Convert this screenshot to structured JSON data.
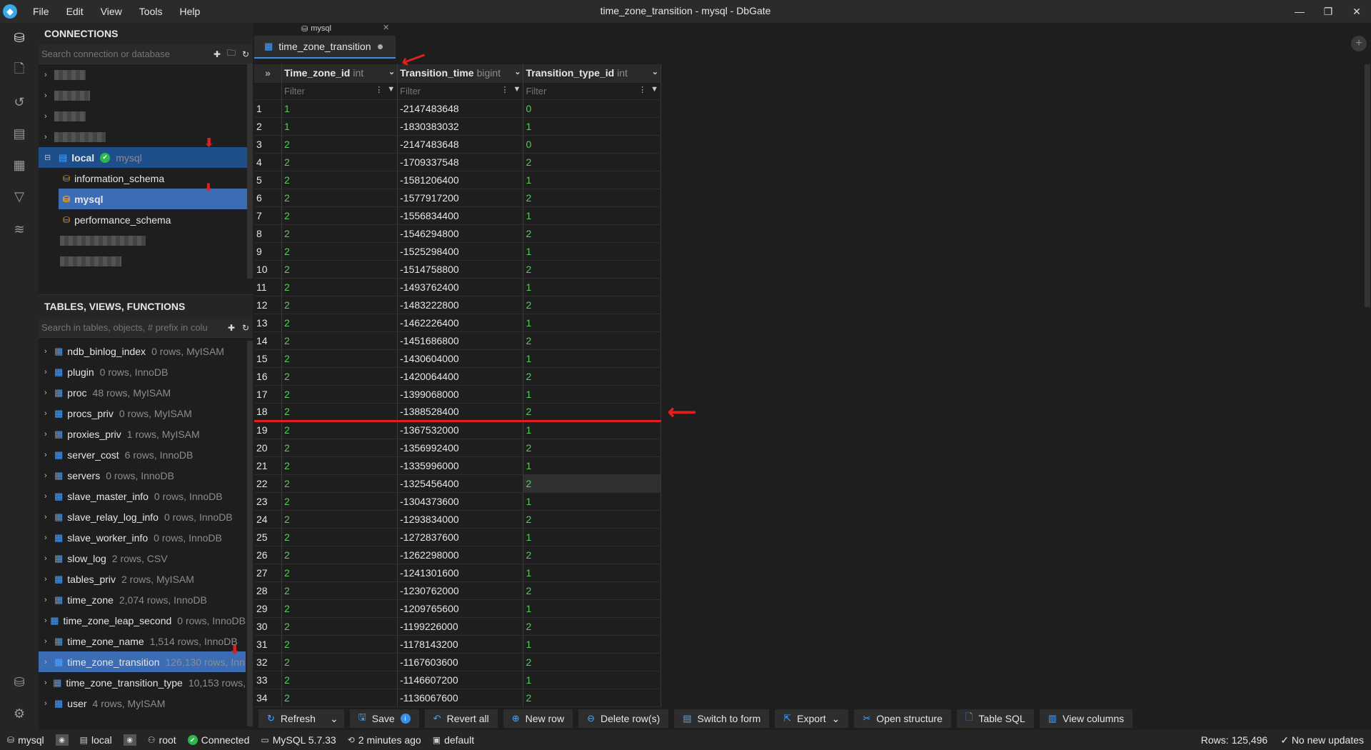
{
  "window": {
    "title": "time_zone_transition - mysql - DbGate"
  },
  "menu": [
    "File",
    "Edit",
    "View",
    "Tools",
    "Help"
  ],
  "connections": {
    "header": "CONNECTIONS",
    "search_placeholder": "Search connection or database",
    "local": {
      "name": "local",
      "db_label": "mysql"
    },
    "databases": [
      "information_schema",
      "mysql",
      "performance_schema"
    ]
  },
  "tables": {
    "header": "TABLES, VIEWS, FUNCTIONS",
    "search_placeholder": "Search in tables, objects, # prefix in colu",
    "items": [
      {
        "name": "ndb_binlog_index",
        "info": "0 rows, MyISAM"
      },
      {
        "name": "plugin",
        "info": "0 rows, InnoDB"
      },
      {
        "name": "proc",
        "info": "48 rows, MyISAM"
      },
      {
        "name": "procs_priv",
        "info": "0 rows, MyISAM"
      },
      {
        "name": "proxies_priv",
        "info": "1 rows, MyISAM"
      },
      {
        "name": "server_cost",
        "info": "6 rows, InnoDB"
      },
      {
        "name": "servers",
        "info": "0 rows, InnoDB"
      },
      {
        "name": "slave_master_info",
        "info": "0 rows, InnoDB"
      },
      {
        "name": "slave_relay_log_info",
        "info": "0 rows, InnoDB"
      },
      {
        "name": "slave_worker_info",
        "info": "0 rows, InnoDB"
      },
      {
        "name": "slow_log",
        "info": "2 rows, CSV"
      },
      {
        "name": "tables_priv",
        "info": "2 rows, MyISAM"
      },
      {
        "name": "time_zone",
        "info": "2,074 rows, InnoDB"
      },
      {
        "name": "time_zone_leap_second",
        "info": "0 rows, InnoDB"
      },
      {
        "name": "time_zone_name",
        "info": "1,514 rows, InnoDB"
      },
      {
        "name": "time_zone_transition",
        "info": "126,130 rows, Inn"
      },
      {
        "name": "time_zone_transition_type",
        "info": "10,153 rows,"
      },
      {
        "name": "user",
        "info": "4 rows, MyISAM"
      }
    ]
  },
  "tab": {
    "group_label": "mysql",
    "label": "time_zone_transition"
  },
  "grid": {
    "columns": [
      {
        "name": "Time_zone_id",
        "type": "int"
      },
      {
        "name": "Transition_time",
        "type": "bigint"
      },
      {
        "name": "Transition_type_id",
        "type": "int"
      }
    ],
    "filter_placeholder": "Filter",
    "rows": [
      [
        "1",
        "1",
        "-2147483648",
        "0"
      ],
      [
        "2",
        "1",
        "-1830383032",
        "1"
      ],
      [
        "3",
        "2",
        "-2147483648",
        "0"
      ],
      [
        "4",
        "2",
        "-1709337548",
        "2"
      ],
      [
        "5",
        "2",
        "-1581206400",
        "1"
      ],
      [
        "6",
        "2",
        "-1577917200",
        "2"
      ],
      [
        "7",
        "2",
        "-1556834400",
        "1"
      ],
      [
        "8",
        "2",
        "-1546294800",
        "2"
      ],
      [
        "9",
        "2",
        "-1525298400",
        "1"
      ],
      [
        "10",
        "2",
        "-1514758800",
        "2"
      ],
      [
        "11",
        "2",
        "-1493762400",
        "1"
      ],
      [
        "12",
        "2",
        "-1483222800",
        "2"
      ],
      [
        "13",
        "2",
        "-1462226400",
        "1"
      ],
      [
        "14",
        "2",
        "-1451686800",
        "2"
      ],
      [
        "15",
        "2",
        "-1430604000",
        "1"
      ],
      [
        "16",
        "2",
        "-1420064400",
        "2"
      ],
      [
        "17",
        "2",
        "-1399068000",
        "1"
      ],
      [
        "18",
        "2",
        "-1388528400",
        "2"
      ],
      [
        "19",
        "2",
        "-1367532000",
        "1"
      ],
      [
        "20",
        "2",
        "-1356992400",
        "2"
      ],
      [
        "21",
        "2",
        "-1335996000",
        "1"
      ],
      [
        "22",
        "2",
        "-1325456400",
        "2"
      ],
      [
        "23",
        "2",
        "-1304373600",
        "1"
      ],
      [
        "24",
        "2",
        "-1293834000",
        "2"
      ],
      [
        "25",
        "2",
        "-1272837600",
        "1"
      ],
      [
        "26",
        "2",
        "-1262298000",
        "2"
      ],
      [
        "27",
        "2",
        "-1241301600",
        "1"
      ],
      [
        "28",
        "2",
        "-1230762000",
        "2"
      ],
      [
        "29",
        "2",
        "-1209765600",
        "1"
      ],
      [
        "30",
        "2",
        "-1199226000",
        "2"
      ],
      [
        "31",
        "2",
        "-1178143200",
        "1"
      ],
      [
        "32",
        "2",
        "-1167603600",
        "2"
      ],
      [
        "33",
        "2",
        "-1146607200",
        "1"
      ],
      [
        "34",
        "2",
        "-1136067600",
        "2"
      ]
    ]
  },
  "toolbar": [
    "Refresh",
    "Save",
    "Revert all",
    "New row",
    "Delete row(s)",
    "Switch to form",
    "Export",
    "Open structure",
    "Table SQL",
    "View columns"
  ],
  "status": {
    "db": "mysql",
    "conn": "local",
    "user": "root",
    "state": "Connected",
    "version": "MySQL 5.7.33",
    "time": "2 minutes ago",
    "schema": "default",
    "rows": "Rows: 125,496",
    "updates": "No new updates"
  },
  "colors": {
    "accent": "#3d8ee8",
    "selected": "#3c6db4",
    "number": "#5cc95c",
    "arrow": "#e02020"
  }
}
